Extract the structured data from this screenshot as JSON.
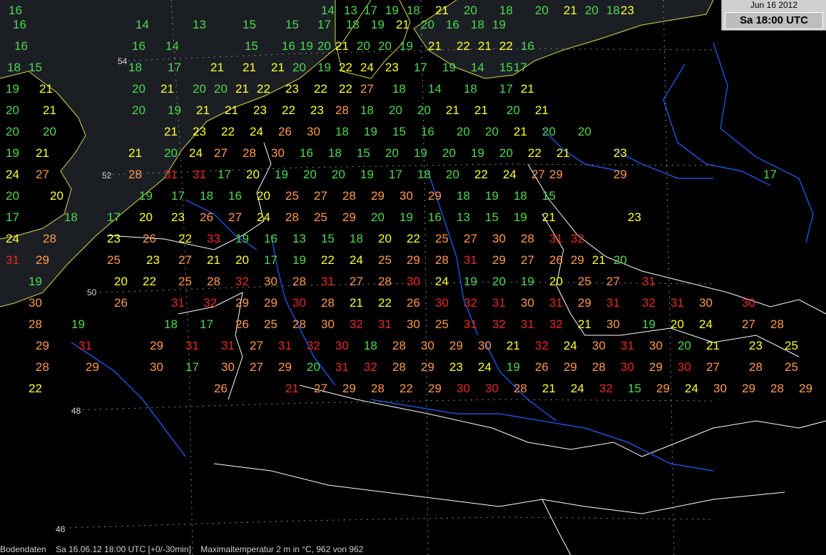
{
  "header": {
    "date": "Jun 16 2012",
    "time": "Sa 18:00 UTC"
  },
  "footer": {
    "source": "Bodendaten",
    "stamp": "Sa 16.06.12 18:00 UTC [+0/-30min]",
    "parameter": "Maximaltemperatur 2 m in °C, 962 von 962"
  },
  "latitude_labels": [
    "54",
    "52",
    "50",
    "48",
    "46"
  ],
  "colors": {
    "sea": "#1b1f24",
    "land": "#000000",
    "coast": "#d9d94a",
    "border": "#ffffff",
    "river": "#1f4fd8",
    "cold": "#4fd84f",
    "mild": "#ffff33",
    "warm": "#ff9a4a",
    "hot": "#e82a1e"
  },
  "stations": [
    {
      "v": 16,
      "c": "cold"
    },
    {
      "v": 14,
      "c": "cold"
    },
    {
      "v": 13,
      "c": "cold"
    },
    {
      "v": 17,
      "c": "cold"
    },
    {
      "v": 19,
      "c": "cold"
    },
    {
      "v": 18,
      "c": "cold"
    },
    {
      "v": 21,
      "c": "mild"
    },
    {
      "v": 20,
      "c": "cold"
    },
    {
      "v": 18,
      "c": "cold"
    },
    {
      "v": 20,
      "c": "cold"
    },
    {
      "v": 21,
      "c": "mild"
    },
    {
      "v": 20,
      "c": "cold"
    },
    {
      "v": 18,
      "c": "cold"
    },
    {
      "v": 23,
      "c": "mild"
    },
    {
      "v": 16,
      "c": "cold"
    },
    {
      "v": 13,
      "c": "cold"
    },
    {
      "v": 14,
      "c": "cold"
    },
    {
      "v": 15,
      "c": "cold"
    },
    {
      "v": 15,
      "c": "cold"
    },
    {
      "v": 17,
      "c": "cold"
    },
    {
      "v": 18,
      "c": "cold"
    },
    {
      "v": 19,
      "c": "cold"
    },
    {
      "v": 21,
      "c": "mild"
    },
    {
      "v": 20,
      "c": "cold"
    },
    {
      "v": 16,
      "c": "cold"
    },
    {
      "v": 18,
      "c": "cold"
    },
    {
      "v": 19,
      "c": "cold"
    },
    {
      "v": 16,
      "c": "cold"
    },
    {
      "v": 16,
      "c": "cold"
    },
    {
      "v": 14,
      "c": "cold"
    },
    {
      "v": 15,
      "c": "cold"
    },
    {
      "v": 16,
      "c": "cold"
    },
    {
      "v": 19,
      "c": "cold"
    },
    {
      "v": 20,
      "c": "cold"
    },
    {
      "v": 21,
      "c": "mild"
    },
    {
      "v": 20,
      "c": "cold"
    },
    {
      "v": 20,
      "c": "cold"
    },
    {
      "v": 19,
      "c": "cold"
    },
    {
      "v": 21,
      "c": "mild"
    },
    {
      "v": 22,
      "c": "mild"
    },
    {
      "v": 21,
      "c": "mild"
    },
    {
      "v": 22,
      "c": "mild"
    },
    {
      "v": 16,
      "c": "cold"
    },
    {
      "v": 18,
      "c": "cold"
    },
    {
      "v": 15,
      "c": "cold"
    },
    {
      "v": 18,
      "c": "cold"
    },
    {
      "v": 17,
      "c": "cold"
    },
    {
      "v": 21,
      "c": "mild"
    },
    {
      "v": 21,
      "c": "mild"
    },
    {
      "v": 21,
      "c": "mild"
    },
    {
      "v": 20,
      "c": "cold"
    },
    {
      "v": 19,
      "c": "cold"
    },
    {
      "v": 22,
      "c": "mild"
    },
    {
      "v": 24,
      "c": "mild"
    },
    {
      "v": 23,
      "c": "mild"
    },
    {
      "v": 17,
      "c": "cold"
    },
    {
      "v": 19,
      "c": "cold"
    },
    {
      "v": 14,
      "c": "cold"
    },
    {
      "v": 15,
      "c": "cold"
    },
    {
      "v": 17,
      "c": "cold"
    },
    {
      "v": 19,
      "c": "cold"
    },
    {
      "v": 21,
      "c": "mild"
    },
    {
      "v": 20,
      "c": "cold"
    },
    {
      "v": 21,
      "c": "mild"
    },
    {
      "v": 20,
      "c": "cold"
    },
    {
      "v": 20,
      "c": "cold"
    },
    {
      "v": 21,
      "c": "mild"
    },
    {
      "v": 22,
      "c": "mild"
    },
    {
      "v": 23,
      "c": "mild"
    },
    {
      "v": 22,
      "c": "mild"
    },
    {
      "v": 22,
      "c": "mild"
    },
    {
      "v": 27,
      "c": "warm"
    },
    {
      "v": 18,
      "c": "cold"
    },
    {
      "v": 14,
      "c": "cold"
    },
    {
      "v": 18,
      "c": "cold"
    },
    {
      "v": 17,
      "c": "cold"
    },
    {
      "v": 21,
      "c": "mild"
    },
    {
      "v": 20,
      "c": "cold"
    },
    {
      "v": 21,
      "c": "mild"
    },
    {
      "v": 20,
      "c": "cold"
    },
    {
      "v": 19,
      "c": "cold"
    },
    {
      "v": 21,
      "c": "mild"
    },
    {
      "v": 21,
      "c": "mild"
    },
    {
      "v": 23,
      "c": "mild"
    },
    {
      "v": 22,
      "c": "mild"
    },
    {
      "v": 23,
      "c": "mild"
    },
    {
      "v": 28,
      "c": "warm"
    },
    {
      "v": 18,
      "c": "cold"
    },
    {
      "v": 20,
      "c": "cold"
    },
    {
      "v": 20,
      "c": "cold"
    },
    {
      "v": 21,
      "c": "mild"
    },
    {
      "v": 21,
      "c": "mild"
    },
    {
      "v": 20,
      "c": "cold"
    },
    {
      "v": 21,
      "c": "mild"
    },
    {
      "v": 20,
      "c": "cold"
    },
    {
      "v": 20,
      "c": "cold"
    },
    {
      "v": 21,
      "c": "mild"
    },
    {
      "v": 23,
      "c": "mild"
    },
    {
      "v": 22,
      "c": "mild"
    },
    {
      "v": 24,
      "c": "mild"
    },
    {
      "v": 26,
      "c": "warm"
    },
    {
      "v": 30,
      "c": "warm"
    },
    {
      "v": 18,
      "c": "cold"
    },
    {
      "v": 19,
      "c": "cold"
    },
    {
      "v": 15,
      "c": "cold"
    },
    {
      "v": 16,
      "c": "cold"
    },
    {
      "v": 20,
      "c": "cold"
    },
    {
      "v": 20,
      "c": "cold"
    },
    {
      "v": 21,
      "c": "mild"
    },
    {
      "v": 20,
      "c": "cold"
    },
    {
      "v": 20,
      "c": "cold"
    },
    {
      "v": 19,
      "c": "cold"
    },
    {
      "v": 21,
      "c": "mild"
    },
    {
      "v": 21,
      "c": "mild"
    },
    {
      "v": 20,
      "c": "cold"
    },
    {
      "v": 24,
      "c": "mild"
    },
    {
      "v": 27,
      "c": "warm"
    },
    {
      "v": 28,
      "c": "warm"
    },
    {
      "v": 30,
      "c": "warm"
    },
    {
      "v": 16,
      "c": "cold"
    },
    {
      "v": 18,
      "c": "cold"
    },
    {
      "v": 15,
      "c": "cold"
    },
    {
      "v": 20,
      "c": "cold"
    },
    {
      "v": 19,
      "c": "cold"
    },
    {
      "v": 20,
      "c": "cold"
    },
    {
      "v": 19,
      "c": "cold"
    },
    {
      "v": 20,
      "c": "cold"
    },
    {
      "v": 22,
      "c": "mild"
    },
    {
      "v": 21,
      "c": "mild"
    },
    {
      "v": 23,
      "c": "mild"
    },
    {
      "v": 24,
      "c": "mild"
    },
    {
      "v": 27,
      "c": "warm"
    },
    {
      "v": 28,
      "c": "warm"
    },
    {
      "v": 31,
      "c": "hot"
    },
    {
      "v": 31,
      "c": "hot"
    },
    {
      "v": 17,
      "c": "cold"
    },
    {
      "v": 20,
      "c": "mild"
    },
    {
      "v": 19,
      "c": "cold"
    },
    {
      "v": 20,
      "c": "cold"
    },
    {
      "v": 20,
      "c": "cold"
    },
    {
      "v": 19,
      "c": "cold"
    },
    {
      "v": 17,
      "c": "cold"
    },
    {
      "v": 18,
      "c": "cold"
    },
    {
      "v": 20,
      "c": "cold"
    },
    {
      "v": 22,
      "c": "mild"
    },
    {
      "v": 24,
      "c": "mild"
    },
    {
      "v": 27,
      "c": "warm"
    },
    {
      "v": 29,
      "c": "warm"
    },
    {
      "v": 29,
      "c": "warm"
    },
    {
      "v": 17,
      "c": "cold"
    },
    {
      "v": 20,
      "c": "cold"
    },
    {
      "v": 20,
      "c": "mild"
    },
    {
      "v": 19,
      "c": "cold"
    },
    {
      "v": 17,
      "c": "cold"
    },
    {
      "v": 18,
      "c": "cold"
    },
    {
      "v": 16,
      "c": "cold"
    },
    {
      "v": 20,
      "c": "mild"
    },
    {
      "v": 25,
      "c": "warm"
    },
    {
      "v": 27,
      "c": "warm"
    },
    {
      "v": 28,
      "c": "warm"
    },
    {
      "v": 29,
      "c": "warm"
    },
    {
      "v": 30,
      "c": "warm"
    },
    {
      "v": 29,
      "c": "warm"
    },
    {
      "v": 18,
      "c": "cold"
    },
    {
      "v": 19,
      "c": "cold"
    },
    {
      "v": 18,
      "c": "cold"
    },
    {
      "v": 15,
      "c": "cold"
    },
    {
      "v": 17,
      "c": "cold"
    },
    {
      "v": 18,
      "c": "cold"
    },
    {
      "v": 17,
      "c": "cold"
    },
    {
      "v": 20,
      "c": "mild"
    },
    {
      "v": 23,
      "c": "mild"
    },
    {
      "v": 26,
      "c": "warm"
    },
    {
      "v": 27,
      "c": "warm"
    },
    {
      "v": 24,
      "c": "mild"
    },
    {
      "v": 28,
      "c": "warm"
    },
    {
      "v": 25,
      "c": "warm"
    },
    {
      "v": 29,
      "c": "warm"
    },
    {
      "v": 20,
      "c": "cold"
    },
    {
      "v": 19,
      "c": "cold"
    },
    {
      "v": 16,
      "c": "cold"
    },
    {
      "v": 13,
      "c": "cold"
    },
    {
      "v": 15,
      "c": "cold"
    },
    {
      "v": 19,
      "c": "cold"
    },
    {
      "v": 21,
      "c": "mild"
    },
    {
      "v": 23,
      "c": "mild"
    },
    {
      "v": 24,
      "c": "mild"
    },
    {
      "v": 28,
      "c": "warm"
    },
    {
      "v": 23,
      "c": "mild"
    },
    {
      "v": 26,
      "c": "warm"
    },
    {
      "v": 22,
      "c": "mild"
    },
    {
      "v": 33,
      "c": "hot"
    },
    {
      "v": 19,
      "c": "cold"
    },
    {
      "v": 16,
      "c": "cold"
    },
    {
      "v": 13,
      "c": "cold"
    },
    {
      "v": 15,
      "c": "cold"
    },
    {
      "v": 18,
      "c": "cold"
    },
    {
      "v": 20,
      "c": "mild"
    },
    {
      "v": 22,
      "c": "mild"
    },
    {
      "v": 25,
      "c": "warm"
    },
    {
      "v": 27,
      "c": "warm"
    },
    {
      "v": 30,
      "c": "warm"
    },
    {
      "v": 28,
      "c": "warm"
    },
    {
      "v": 31,
      "c": "hot"
    },
    {
      "v": 32,
      "c": "hot"
    },
    {
      "v": 31,
      "c": "hot"
    },
    {
      "v": 29,
      "c": "warm"
    },
    {
      "v": 25,
      "c": "warm"
    },
    {
      "v": 23,
      "c": "mild"
    },
    {
      "v": 27,
      "c": "warm"
    },
    {
      "v": 21,
      "c": "mild"
    },
    {
      "v": 20,
      "c": "mild"
    },
    {
      "v": 17,
      "c": "cold"
    },
    {
      "v": 19,
      "c": "cold"
    },
    {
      "v": 22,
      "c": "mild"
    },
    {
      "v": 24,
      "c": "mild"
    },
    {
      "v": 25,
      "c": "warm"
    },
    {
      "v": 29,
      "c": "warm"
    },
    {
      "v": 28,
      "c": "warm"
    },
    {
      "v": 31,
      "c": "hot"
    },
    {
      "v": 29,
      "c": "warm"
    },
    {
      "v": 27,
      "c": "warm"
    },
    {
      "v": 26,
      "c": "warm"
    },
    {
      "v": 29,
      "c": "warm"
    },
    {
      "v": 21,
      "c": "mild"
    },
    {
      "v": 20,
      "c": "cold"
    },
    {
      "v": 19,
      "c": "cold"
    },
    {
      "v": 20,
      "c": "mild"
    },
    {
      "v": 22,
      "c": "mild"
    },
    {
      "v": 25,
      "c": "warm"
    },
    {
      "v": 28,
      "c": "warm"
    },
    {
      "v": 32,
      "c": "hot"
    },
    {
      "v": 30,
      "c": "warm"
    },
    {
      "v": 28,
      "c": "warm"
    },
    {
      "v": 31,
      "c": "hot"
    },
    {
      "v": 27,
      "c": "warm"
    },
    {
      "v": 28,
      "c": "warm"
    },
    {
      "v": 30,
      "c": "hot"
    },
    {
      "v": 24,
      "c": "mild"
    },
    {
      "v": 19,
      "c": "cold"
    },
    {
      "v": 20,
      "c": "cold"
    },
    {
      "v": 19,
      "c": "cold"
    },
    {
      "v": 20,
      "c": "mild"
    },
    {
      "v": 25,
      "c": "warm"
    },
    {
      "v": 27,
      "c": "warm"
    },
    {
      "v": 31,
      "c": "hot"
    },
    {
      "v": 30,
      "c": "warm"
    },
    {
      "v": 26,
      "c": "warm"
    },
    {
      "v": 31,
      "c": "hot"
    },
    {
      "v": 32,
      "c": "hot"
    },
    {
      "v": 29,
      "c": "warm"
    },
    {
      "v": 29,
      "c": "warm"
    },
    {
      "v": 30,
      "c": "hot"
    },
    {
      "v": 28,
      "c": "warm"
    },
    {
      "v": 21,
      "c": "mild"
    },
    {
      "v": 22,
      "c": "mild"
    },
    {
      "v": 26,
      "c": "warm"
    },
    {
      "v": 30,
      "c": "hot"
    },
    {
      "v": 32,
      "c": "hot"
    },
    {
      "v": 31,
      "c": "hot"
    },
    {
      "v": 30,
      "c": "warm"
    },
    {
      "v": 31,
      "c": "hot"
    },
    {
      "v": 29,
      "c": "warm"
    },
    {
      "v": 31,
      "c": "hot"
    },
    {
      "v": 32,
      "c": "hot"
    },
    {
      "v": 31,
      "c": "hot"
    },
    {
      "v": 30,
      "c": "warm"
    },
    {
      "v": 30,
      "c": "hot"
    },
    {
      "v": 28,
      "c": "warm"
    },
    {
      "v": 19,
      "c": "cold"
    },
    {
      "v": 18,
      "c": "cold"
    },
    {
      "v": 17,
      "c": "cold"
    },
    {
      "v": 26,
      "c": "warm"
    },
    {
      "v": 25,
      "c": "warm"
    },
    {
      "v": 28,
      "c": "warm"
    },
    {
      "v": 30,
      "c": "warm"
    },
    {
      "v": 32,
      "c": "hot"
    },
    {
      "v": 31,
      "c": "hot"
    },
    {
      "v": 30,
      "c": "warm"
    },
    {
      "v": 25,
      "c": "warm"
    },
    {
      "v": 31,
      "c": "hot"
    },
    {
      "v": 32,
      "c": "hot"
    },
    {
      "v": 31,
      "c": "hot"
    },
    {
      "v": 32,
      "c": "hot"
    },
    {
      "v": 21,
      "c": "mild"
    },
    {
      "v": 30,
      "c": "warm"
    },
    {
      "v": 19,
      "c": "cold"
    },
    {
      "v": 20,
      "c": "mild"
    },
    {
      "v": 24,
      "c": "mild"
    },
    {
      "v": 27,
      "c": "warm"
    },
    {
      "v": 28,
      "c": "warm"
    },
    {
      "v": 29,
      "c": "warm"
    },
    {
      "v": 31,
      "c": "hot"
    },
    {
      "v": 29,
      "c": "warm"
    },
    {
      "v": 31,
      "c": "hot"
    },
    {
      "v": 31,
      "c": "hot"
    },
    {
      "v": 27,
      "c": "warm"
    },
    {
      "v": 31,
      "c": "hot"
    },
    {
      "v": 32,
      "c": "hot"
    },
    {
      "v": 30,
      "c": "hot"
    },
    {
      "v": 18,
      "c": "cold"
    },
    {
      "v": 28,
      "c": "warm"
    },
    {
      "v": 30,
      "c": "warm"
    },
    {
      "v": 29,
      "c": "warm"
    },
    {
      "v": 30,
      "c": "warm"
    },
    {
      "v": 21,
      "c": "mild"
    },
    {
      "v": 32,
      "c": "hot"
    },
    {
      "v": 24,
      "c": "mild"
    },
    {
      "v": 30,
      "c": "warm"
    },
    {
      "v": 31,
      "c": "hot"
    },
    {
      "v": 30,
      "c": "warm"
    },
    {
      "v": 20,
      "c": "cold"
    },
    {
      "v": 21,
      "c": "mild"
    },
    {
      "v": 23,
      "c": "mild"
    },
    {
      "v": 25,
      "c": "mild"
    },
    {
      "v": 28,
      "c": "warm"
    },
    {
      "v": 29,
      "c": "warm"
    },
    {
      "v": 30,
      "c": "warm"
    },
    {
      "v": 17,
      "c": "cold"
    },
    {
      "v": 30,
      "c": "warm"
    },
    {
      "v": 27,
      "c": "warm"
    },
    {
      "v": 29,
      "c": "warm"
    },
    {
      "v": 20,
      "c": "cold"
    },
    {
      "v": 31,
      "c": "hot"
    },
    {
      "v": 32,
      "c": "hot"
    },
    {
      "v": 28,
      "c": "warm"
    },
    {
      "v": 29,
      "c": "warm"
    },
    {
      "v": 23,
      "c": "mild"
    },
    {
      "v": 24,
      "c": "mild"
    },
    {
      "v": 19,
      "c": "cold"
    },
    {
      "v": 26,
      "c": "warm"
    },
    {
      "v": 29,
      "c": "warm"
    },
    {
      "v": 28,
      "c": "warm"
    },
    {
      "v": 30,
      "c": "hot"
    },
    {
      "v": 29,
      "c": "warm"
    },
    {
      "v": 30,
      "c": "hot"
    },
    {
      "v": 27,
      "c": "warm"
    },
    {
      "v": 28,
      "c": "warm"
    },
    {
      "v": 25,
      "c": "warm"
    },
    {
      "v": 22,
      "c": "mild"
    },
    {
      "v": 26,
      "c": "warm"
    },
    {
      "v": 21,
      "c": "hot"
    },
    {
      "v": 27,
      "c": "warm"
    },
    {
      "v": 29,
      "c": "warm"
    },
    {
      "v": 28,
      "c": "warm"
    },
    {
      "v": 22,
      "c": "warm"
    },
    {
      "v": 29,
      "c": "warm"
    },
    {
      "v": 30,
      "c": "hot"
    },
    {
      "v": 30,
      "c": "hot"
    },
    {
      "v": 28,
      "c": "warm"
    },
    {
      "v": 21,
      "c": "mild"
    },
    {
      "v": 24,
      "c": "mild"
    },
    {
      "v": 32,
      "c": "hot"
    },
    {
      "v": 15,
      "c": "cold"
    },
    {
      "v": 29,
      "c": "warm"
    },
    {
      "v": 24,
      "c": "mild"
    },
    {
      "v": 30,
      "c": "warm"
    },
    {
      "v": 29,
      "c": "warm"
    },
    {
      "v": 28,
      "c": "warm"
    },
    {
      "v": 29,
      "c": "warm"
    }
  ]
}
